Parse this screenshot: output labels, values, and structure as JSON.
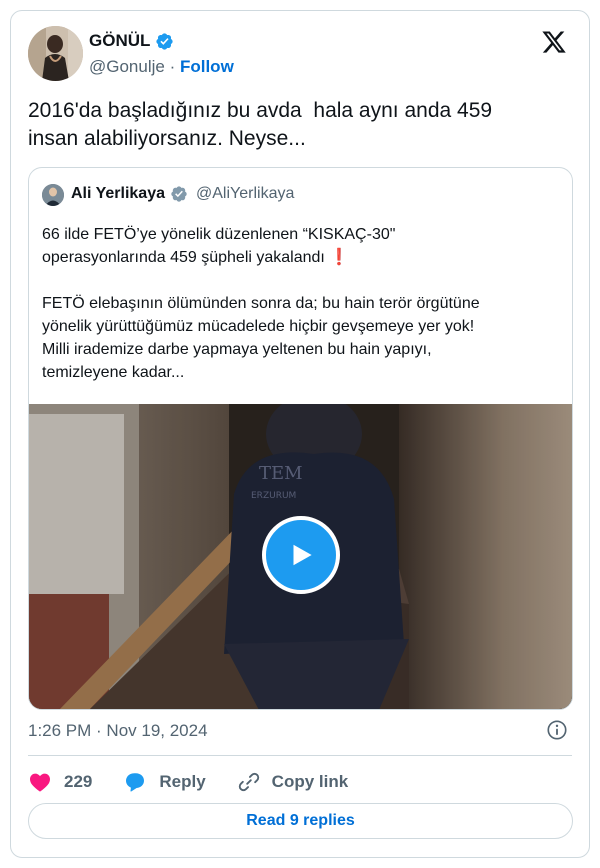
{
  "author": {
    "name": "GÖNÜL",
    "handle": "@Gonulje",
    "separator": " · ",
    "follow_label": "Follow",
    "verified_icon": "verified-badge-icon",
    "logo_icon": "x-logo-icon"
  },
  "tweet": {
    "text": "2016'da başladığınız bu avda  hala aynı anda 459\ninsan alabiliyorsanız. Neyse..."
  },
  "quoted": {
    "name": "Ali Yerlikaya",
    "handle": "@AliYerlikaya",
    "text_main": "66 ilde FETÖ’ye yönelik düzenlenen “KISKAÇ-30\"\noperasyonlarında 459 şüpheli yakalandı ",
    "text_mark": "❗",
    "text_rest": "\n\nFETÖ elebaşının ölümünden sonra da; bu hain terör örgütüne\nyönelik yürüttüğümüz mücadelede hiçbir gevşemeye yer yok!\nMilli irademize darbe yapmaya yeltenen bu hain yapıyı,\ntemizleyene kadar...",
    "video_icon": "play-icon"
  },
  "meta": {
    "timestamp": "1:26 PM · Nov 19, 2024",
    "info_icon": "info-icon"
  },
  "actions": {
    "like_count": "229",
    "reply_label": "Reply",
    "copy_label": "Copy link",
    "read_replies_label": "Read 9 replies"
  },
  "colors": {
    "accent": "#1d9bf0",
    "link": "#006fd6",
    "like": "#f91880",
    "muted": "#536471",
    "border": "#cfd9de"
  }
}
